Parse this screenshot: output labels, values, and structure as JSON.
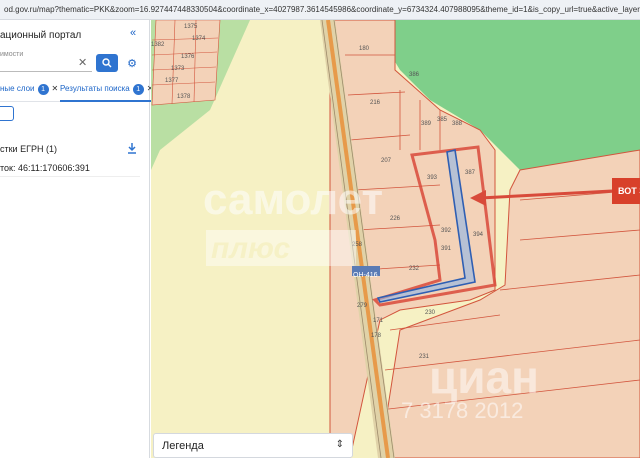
{
  "url": "od.gov.ru/map?thematic=PKK&zoom=16.927447448330504&coordinate_x=4027987.3614545986&coordinate_y=6734324.407988095&theme_id=1&is_copy_url=true&active_layers=",
  "sidebar": {
    "title": "ационный портал",
    "search_label": "имости",
    "search_value": "",
    "tabs": [
      {
        "label": "ные слои",
        "count": "1"
      },
      {
        "label": "Результаты поиска",
        "count": "1"
      }
    ],
    "section_title": "стки ЕГРН (1)",
    "plot_label": "ток: 46:11:170606:391"
  },
  "map": {
    "road_label": "ОН-416",
    "parcel_labels": [
      "1375",
      "1374",
      "1373",
      "1377",
      "1376",
      "1378",
      "1382",
      "180",
      "386",
      "216",
      "389",
      "385",
      "388",
      "207",
      "393",
      "387",
      "226",
      "392",
      "394",
      "391",
      "258",
      "232",
      "279",
      "230",
      "231",
      "171",
      "178"
    ],
    "grid_labels": [
      "1375",
      "1374",
      "1373",
      "1377",
      "1376",
      "1378"
    ],
    "watermark_top": "самолет",
    "watermark_sub": "плюс",
    "watermark_bottom": "циан",
    "watermark_phone": "7 3178 2012",
    "callout": "ВОТ Э",
    "legend": "Легенда"
  },
  "colors": {
    "accent": "#2f74d0",
    "parcel_fill": "#f3d2b8",
    "parcel_stroke": "#d2553d",
    "green": "#7fcf8a",
    "field": "#f6f1c4",
    "road": "#e79a4a",
    "highlight": "#d84a3a"
  }
}
